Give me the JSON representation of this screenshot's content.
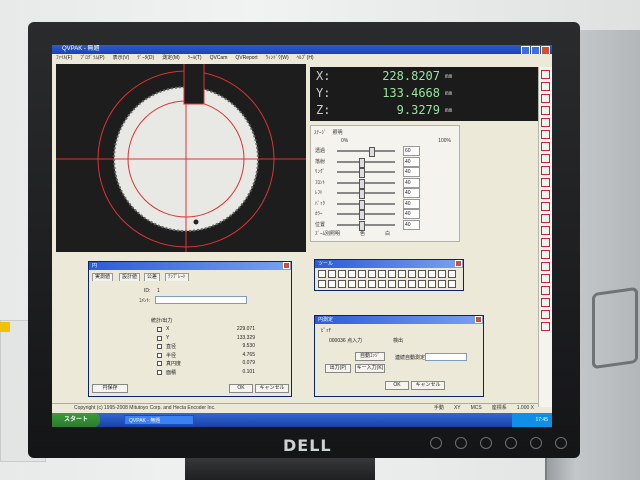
{
  "window": {
    "title": "QVPAK - 無題"
  },
  "menu": [
    "ﾌｧｲﾙ(F)",
    "ﾌﾟﾛｸﾞﾗﾑ(P)",
    "表示(V)",
    "ﾃﾞｰﾀ(D)",
    "測定(M)",
    "ﾂｰﾙ(T)",
    "QVCam",
    "QVReport",
    "ｳｨﾝﾄﾞｳ(W)",
    "ﾍﾙﾌﾟ(H)"
  ],
  "coordinates": {
    "x": {
      "axis": "X:",
      "value": "228.8207",
      "unit": "mm"
    },
    "y": {
      "axis": "Y:",
      "value": "133.4668",
      "unit": "mm"
    },
    "z": {
      "axis": "Z:",
      "value": "9.3279",
      "unit": "mm"
    }
  },
  "lighting": {
    "tabs": [
      "ｽﾃｰｼﾞ",
      "照明"
    ],
    "scale_min": "0%",
    "scale_max": "100%",
    "sliders": [
      {
        "label": "透過",
        "value": "60",
        "level": 0.6
      },
      {
        "label": "落射",
        "value": "40",
        "level": 0.4
      },
      {
        "label": "ﾘﾝｸﾞ",
        "value": "40",
        "level": 0.4
      },
      {
        "label": "ﾌﾛﾝﾄ",
        "value": "40",
        "level": 0.4
      },
      {
        "label": "ﾚﾌﾄ",
        "value": "40",
        "level": 0.4
      },
      {
        "label": "ﾊﾞｯｸ",
        "value": "40",
        "level": 0.4
      },
      {
        "label": "ｶﾗｰ",
        "value": "40",
        "level": 0.4
      },
      {
        "label": "位置",
        "value": "40",
        "level": 0.4
      }
    ],
    "footer_left": "ｽﾞｰﾑ別照明",
    "footer_right": "色",
    "footer_value": "白"
  },
  "circle_dialog": {
    "title": "円",
    "tabs": [
      "実測値",
      "設計値",
      "公差",
      "ﾃﾝﾌﾟﾚｰﾄ"
    ],
    "id_label": "ID:",
    "id_value": "1",
    "name_label": "ｺﾒﾝﾄ:",
    "section_label": "統計/出力",
    "params": [
      {
        "name": "X",
        "value": "229.071"
      },
      {
        "name": "Y",
        "value": "133.329"
      },
      {
        "name": "直径",
        "value": "9.530"
      },
      {
        "name": "半径",
        "value": "4.765"
      },
      {
        "name": "真円度",
        "value": "0.079"
      },
      {
        "name": "面積",
        "value": "0.101"
      }
    ],
    "btn_left": "円保存",
    "btn_ok": "OK",
    "btn_cancel": "キャンセル"
  },
  "toolbar_dialog": {
    "title": "ツール"
  },
  "tool_dialog": {
    "title": "円測定",
    "mode_label": "ﾋﾟｯﾁ",
    "input_label": "000036 点入力",
    "right_label": "検出",
    "btn_auto": "自動ｴｯｼﾞ",
    "btn_output": "出力(P)",
    "btn_key": "キー入力(K)",
    "right_label2": "連続自動測定",
    "btn_ok": "OK",
    "btn_cancel": "キャンセル"
  },
  "statusbar": {
    "copyright": "Copyright (c) 1995-2008 Mitutoyo Corp. and Hecta Encoder Inc.",
    "items": [
      "手動",
      "XY",
      "MCS",
      "座標系",
      "1.000 X"
    ]
  },
  "taskbar": {
    "start": "スタート",
    "task": "QVPAK - 無題",
    "time": "17:45"
  },
  "monitor": {
    "brand": "DELL"
  },
  "colors": {
    "crosshair": "#e0333b",
    "readout_text": "#9be49f",
    "titlebar": "#2b5bd4",
    "taskbar": "#245edb"
  }
}
